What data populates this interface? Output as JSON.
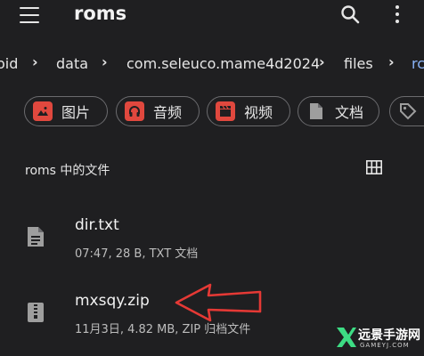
{
  "appbar": {
    "title": "roms"
  },
  "breadcrumb": {
    "items": [
      "oid",
      "data",
      "com.seleuco.mame4d2024",
      "files",
      "rc"
    ],
    "separator": "›"
  },
  "chips": [
    {
      "label": "图片",
      "icon": "image-icon",
      "color": "#e0483e"
    },
    {
      "label": "音频",
      "icon": "headphones-icon",
      "color": "#e0483e"
    },
    {
      "label": "视频",
      "icon": "clapperboard-icon",
      "color": "#e0483e"
    },
    {
      "label": "文档",
      "icon": "document-icon",
      "color": "#9e9e9e"
    },
    {
      "label": "",
      "icon": "tag-icon",
      "color": "#9e9e9e"
    }
  ],
  "section": {
    "title": "roms 中的文件"
  },
  "files": [
    {
      "name": "dir.txt",
      "meta": "07:47, 28 B, TXT 文档",
      "icon": "text-file-icon"
    },
    {
      "name": "mxsqy.zip",
      "meta": "11月3日, 4.82 MB, ZIP 归档文件",
      "icon": "zip-file-icon"
    }
  ],
  "annotation": {
    "color": "#e53935"
  },
  "watermark": {
    "text": "远景手游网",
    "sub": "GAMEYJ.COM",
    "color": "#3ddc84"
  }
}
